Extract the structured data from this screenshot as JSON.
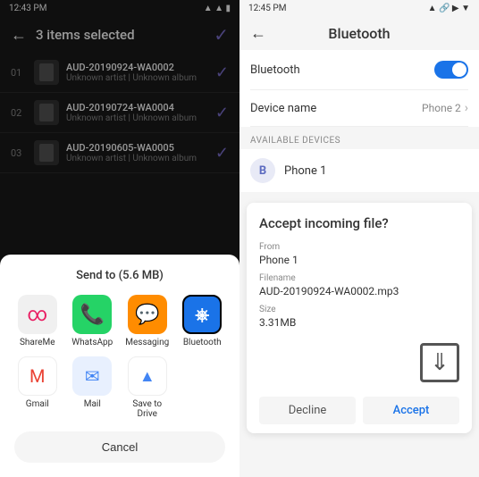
{
  "left": {
    "status_bar": {
      "time": "12:43 PM",
      "icons": "signal wifi battery"
    },
    "top_bar": {
      "title": "3 items selected"
    },
    "files": [
      {
        "number": "01",
        "name": "AUD-20190924-WA0002",
        "meta": "Unknown artist | Unknown album"
      },
      {
        "number": "02",
        "name": "AUD-20190724-WA0004",
        "meta": "Unknown artist | Unknown album"
      },
      {
        "number": "03",
        "name": "AUD-20190605-WA0005",
        "meta": "Unknown artist | Unknown album"
      }
    ],
    "dialog": {
      "title": "Send to (5.6 MB)",
      "items_row1": [
        {
          "label": "ShareMe",
          "icon": "shareme"
        },
        {
          "label": "WhatsApp",
          "icon": "whatsapp"
        },
        {
          "label": "Messaging",
          "icon": "messaging"
        },
        {
          "label": "Bluetooth",
          "icon": "bluetooth"
        }
      ],
      "items_row2": [
        {
          "label": "Gmail",
          "icon": "gmail"
        },
        {
          "label": "Mail",
          "icon": "mail"
        },
        {
          "label": "Save to Drive",
          "icon": "drive"
        }
      ],
      "cancel": "Cancel"
    }
  },
  "right": {
    "status_bar": {
      "time": "12:45 PM",
      "icons": "signal wifi battery"
    },
    "bluetooth_screen": {
      "title": "Bluetooth",
      "bluetooth_label": "Bluetooth",
      "bluetooth_on": true,
      "device_name_label": "Device name",
      "device_name_value": "Phone 2",
      "available_devices_label": "AVAILABLE DEVICES",
      "devices": [
        {
          "initial": "B",
          "name": "Phone 1"
        }
      ]
    },
    "accept_dialog": {
      "title": "Accept incoming file?",
      "from_label": "From",
      "from_value": "Phone 1",
      "filename_label": "Filename",
      "filename_value": "AUD-20190924-WA0002.mp3",
      "size_label": "Size",
      "size_value": "3.31MB",
      "decline_label": "Decline",
      "accept_label": "Accept"
    }
  }
}
